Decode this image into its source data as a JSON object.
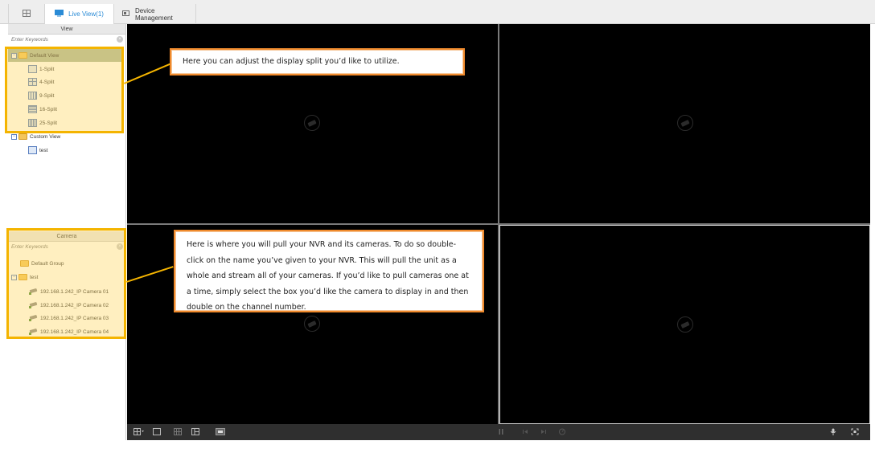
{
  "topbar": {
    "tabs": [
      {
        "label": "",
        "icon": "grid-icon"
      },
      {
        "label": "Live View(1)",
        "icon": "monitor-icon",
        "active": true
      },
      {
        "label": "Device Management",
        "icon": "device-icon"
      }
    ]
  },
  "view_panel": {
    "title": "View",
    "search_placeholder": "Enter Keywords",
    "default_view": {
      "label": "Default View",
      "items": [
        "1-Split",
        "4-Split",
        "9-Split",
        "16-Split",
        "25-Split"
      ]
    },
    "custom_view": {
      "label": "Custom View",
      "items": [
        "test"
      ]
    }
  },
  "camera_panel": {
    "title": "Camera",
    "search_placeholder": "Enter Keywords",
    "default_group": "Default Group",
    "group": {
      "label": "test",
      "cameras": [
        "192.168.1.242_IP Camera 01",
        "192.168.1.242_IP Camera 02",
        "192.168.1.242_IP Camera 03",
        "192.168.1.242_IP Camera 04"
      ]
    }
  },
  "callouts": {
    "split": "Here you can adjust the display split you’d like to utilize.",
    "nvr": "Here is where you will pull your NVR and its cameras.  To do so double-click on the name you’ve given to your NVR.  This will pull the unit as a whole and stream all of your cameras.  If you’d like to pull cameras one at a time, simply select the box you’d like the camera to display in and then double on the channel number."
  },
  "colors": {
    "highlight": "#f4b400",
    "callout_border": "#f08a2c",
    "active_tab_text": "#2a8bd6"
  }
}
